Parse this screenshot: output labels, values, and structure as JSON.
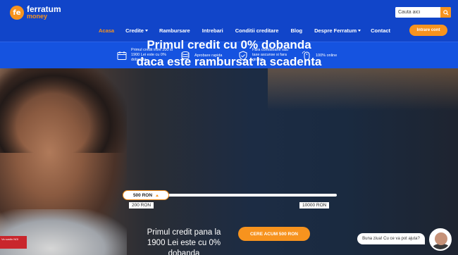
{
  "header": {
    "logo_name": "ferratum",
    "logo_sub": "money",
    "logo_mark": "fe",
    "search_placeholder": "Cauta aici",
    "nav": [
      {
        "label": "Acasa",
        "active": true,
        "dropdown": false
      },
      {
        "label": "Credite",
        "active": false,
        "dropdown": true
      },
      {
        "label": "Rambursare",
        "active": false,
        "dropdown": false
      },
      {
        "label": "Intrebari",
        "active": false,
        "dropdown": false
      },
      {
        "label": "Conditii creditare",
        "active": false,
        "dropdown": false
      },
      {
        "label": "Blog",
        "active": false,
        "dropdown": false
      },
      {
        "label": "Despre Ferratum",
        "active": false,
        "dropdown": true
      },
      {
        "label": "Contact",
        "active": false,
        "dropdown": false
      }
    ],
    "login_label": "Intrare cont"
  },
  "features": [
    {
      "icon": "calendar-icon",
      "text": "Primul credit intre 200 si 1900 Lei este cu 0% dobanda"
    },
    {
      "icon": "coins-icon",
      "text": "Aprobare rapida"
    },
    {
      "icon": "shield-check-icon",
      "text": "Fara comisioane sau taxe ascunse si fara giranti"
    },
    {
      "icon": "mouse-icon",
      "text": "100% online"
    }
  ],
  "hero": {
    "title_line1": "Primul credit cu 0% dobanda",
    "title_line2": "daca este rambursat la scadenta",
    "slider_value": "500 RON",
    "range_min": "200 RON",
    "range_max": "10000 RON",
    "sub_line1": "Primul credit pana la",
    "sub_line2": "1900 Lei este cu 0%",
    "sub_line3": "dobanda",
    "cta_label": "CERE ACUM 500 RON",
    "badge_text": "Va sustin NOI"
  },
  "chat": {
    "bubble_text": "Buna ziua! Cu ce va pot ajuta?"
  },
  "colors": {
    "brand_blue": "#1145c9",
    "accent_orange": "#f7931e"
  }
}
